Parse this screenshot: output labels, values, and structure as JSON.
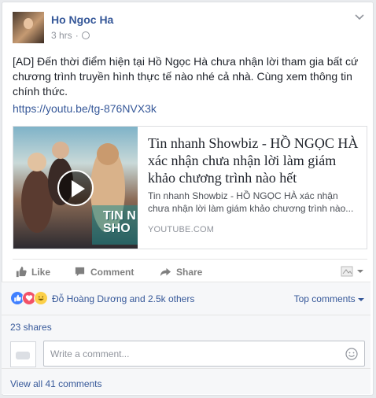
{
  "post": {
    "author": "Ho Ngoc Ha",
    "time": "3 hrs",
    "text": "[AD] Đến thời điểm hiện tại Hồ Ngọc Hà chưa nhận lời tham gia bất cứ chương trình truyền hình thực tế nào nhé cả nhà. Cùng xem thông tin chính thức.",
    "link": "https://youtu.be/tg-876NVX3k"
  },
  "card": {
    "title": "Tin nhanh Showbiz - HỒ NGỌC HÀ xác nhận chưa nhận lời làm giám khảo chương trình nào hết",
    "description": "Tin nhanh Showbiz - HỒ NGỌC HÀ xác nhận chưa nhận lời làm giám khảo chương trình nào...",
    "domain": "YOUTUBE.COM",
    "thumbnail_text": "TIN N SHO"
  },
  "actions": {
    "like": "Like",
    "comment": "Comment",
    "share": "Share"
  },
  "reactions": {
    "summary": "Đỗ Hoàng Dương and 2.5k others",
    "top_comments": "Top comments"
  },
  "shares": "23 shares",
  "comment_box": {
    "placeholder": "Write a comment..."
  },
  "view_all": "View all 41 comments",
  "colors": {
    "link": "#365899",
    "like": "#4080ff",
    "love": "#f25268",
    "haha": "#fcd049"
  }
}
